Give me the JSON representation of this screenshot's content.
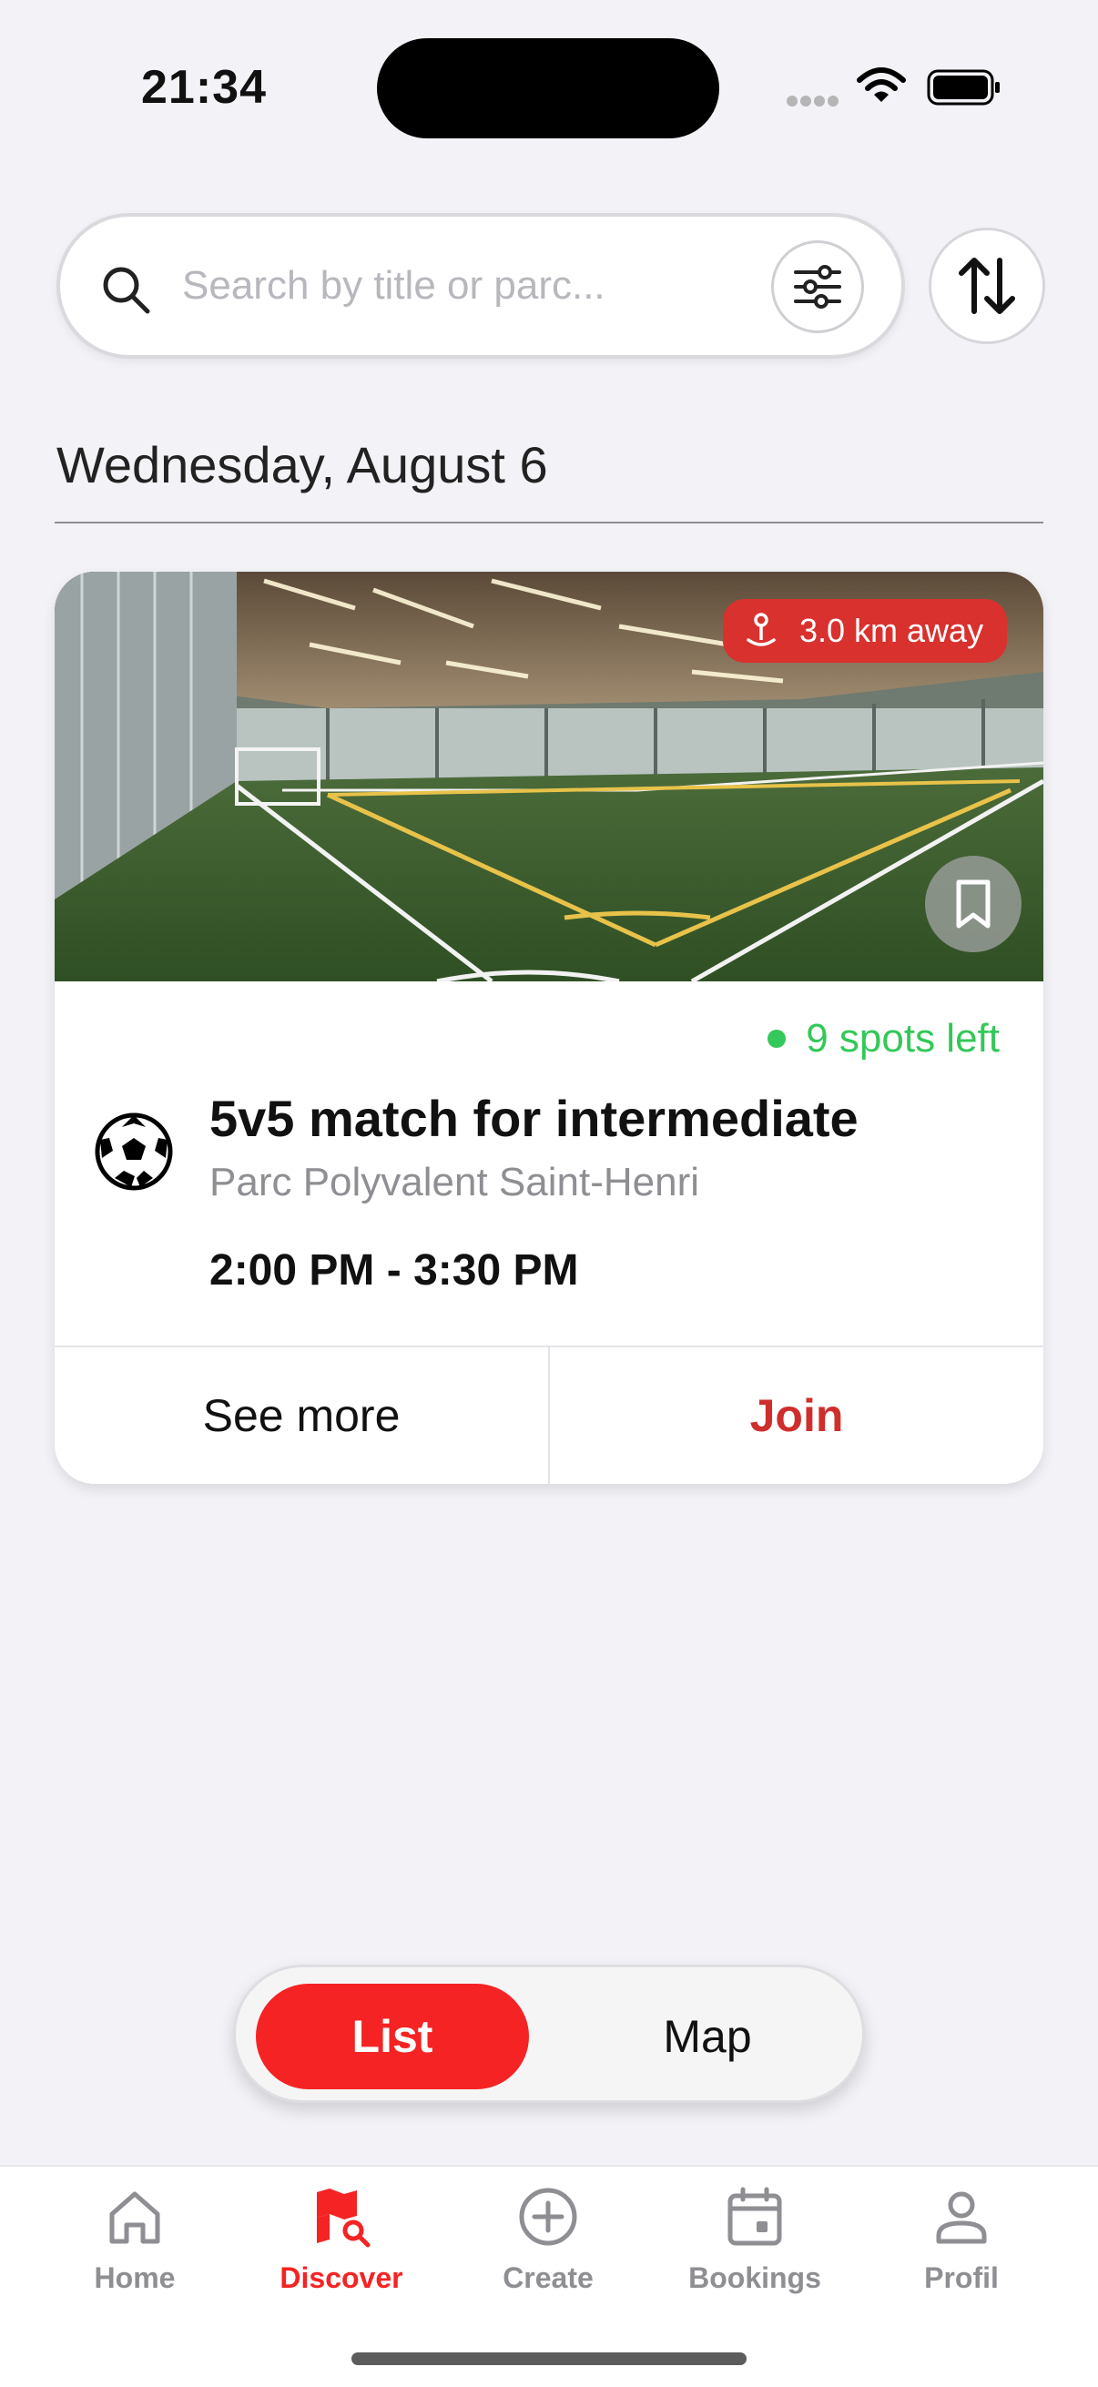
{
  "status_bar": {
    "time": "21:34"
  },
  "search": {
    "placeholder": "Search by title or parc...",
    "value": ""
  },
  "list": {
    "date_header": "Wednesday, August 6",
    "events": [
      {
        "distance": "3.0 km away",
        "spots_left": "9 spots left",
        "sport_icon": "soccer-ball-icon",
        "title": "5v5 match for intermediate",
        "venue": "Parc Polyvalent Saint-Henri",
        "time_range": "2:00 PM - 3:30 PM",
        "see_more_label": "See more",
        "join_label": "Join"
      }
    ]
  },
  "view_toggle": {
    "list_label": "List",
    "map_label": "Map",
    "selected": "List"
  },
  "tab_bar": {
    "items": [
      {
        "label": "Home",
        "icon": "home-icon"
      },
      {
        "label": "Discover",
        "icon": "discover-map-icon",
        "active": true
      },
      {
        "label": "Create",
        "icon": "plus-circle-icon"
      },
      {
        "label": "Bookings",
        "icon": "calendar-icon"
      },
      {
        "label": "Profil",
        "icon": "person-icon"
      }
    ]
  },
  "colors": {
    "accent": "#f52323",
    "join_text": "#cf2f2c",
    "badge": "#d9312e",
    "available": "#34c759",
    "background": "#f2f2f7"
  }
}
